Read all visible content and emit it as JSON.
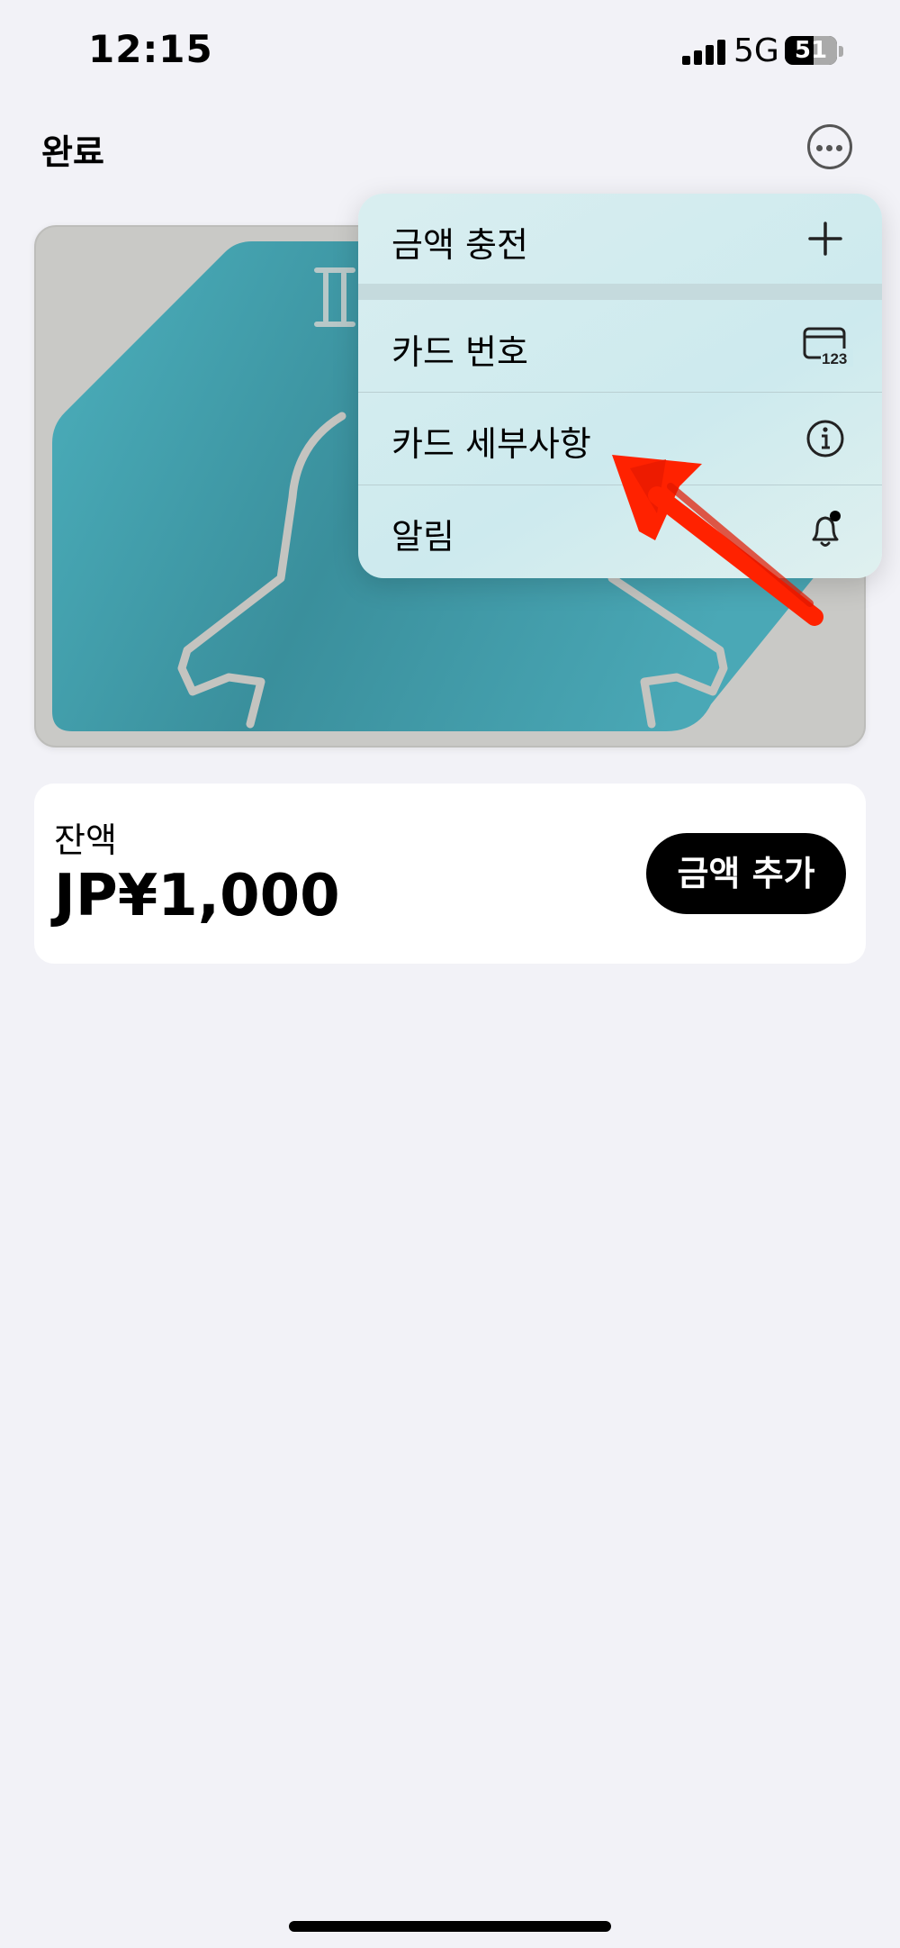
{
  "status_bar": {
    "time": "12:15",
    "network": "5G",
    "battery": "51"
  },
  "nav": {
    "done": "완료"
  },
  "menu": {
    "items": [
      {
        "label": "금액 충전",
        "icon": "plus-icon"
      },
      {
        "label": "카드 번호",
        "icon": "card-number-icon",
        "icon_text": "123"
      },
      {
        "label": "카드 세부사항",
        "icon": "info-icon"
      },
      {
        "label": "알림",
        "icon": "bell-badge-icon"
      }
    ]
  },
  "balance": {
    "label": "잔액",
    "amount": "JP¥1,000",
    "button": "금액 추가"
  },
  "colors": {
    "card_teal": "#4aa6b5",
    "card_gray": "#c9c9c6",
    "annotation": "#ff2200",
    "menu_bg": "#d4ecef"
  }
}
